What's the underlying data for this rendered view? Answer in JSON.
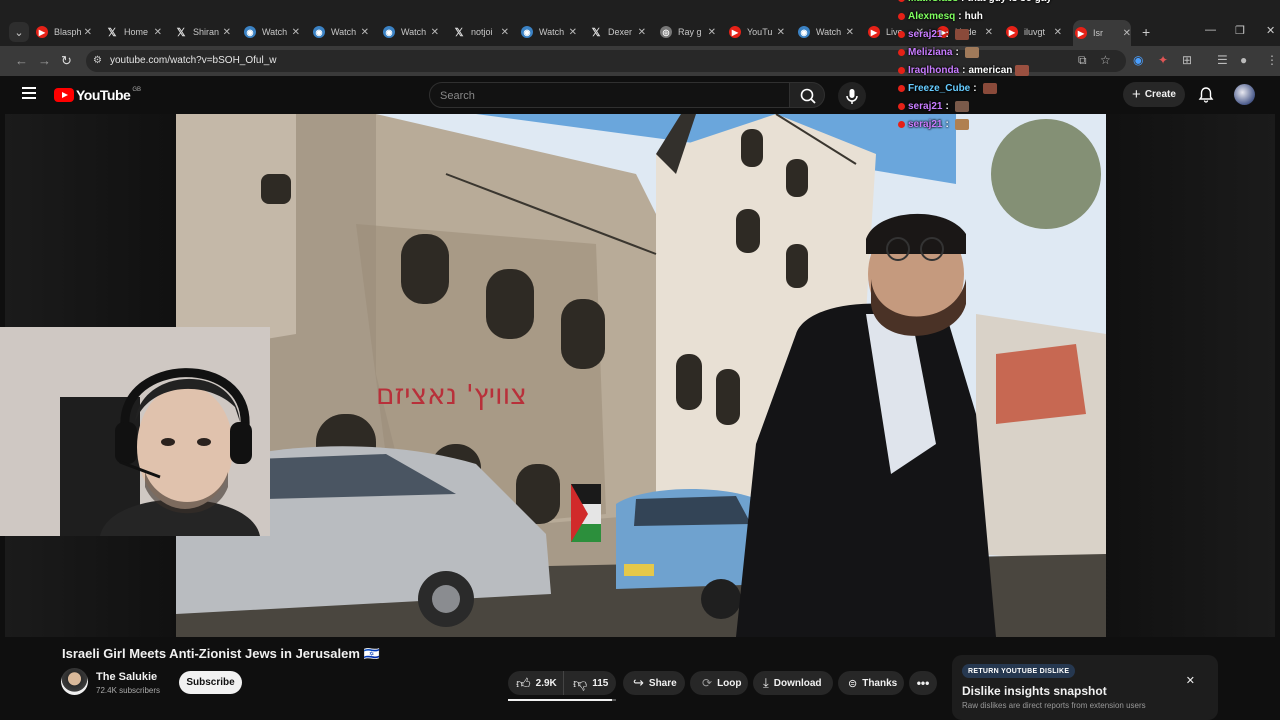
{
  "browser": {
    "tabs": [
      {
        "label": "Blasph",
        "icon": "youtube-icon"
      },
      {
        "label": "Home",
        "icon": "x-icon"
      },
      {
        "label": "Shiran",
        "icon": "x-icon"
      },
      {
        "label": "Watch",
        "icon": "watch-icon"
      },
      {
        "label": "Watch",
        "icon": "watch-icon"
      },
      {
        "label": "Watch",
        "icon": "watch-icon"
      },
      {
        "label": "notjoi",
        "icon": "x-icon"
      },
      {
        "label": "Watch",
        "icon": "watch-icon"
      },
      {
        "label": "Dexer",
        "icon": "x-icon"
      },
      {
        "label": "Ray g",
        "icon": "chrome-icon"
      },
      {
        "label": "YouTu",
        "icon": "youtube-icon"
      },
      {
        "label": "Watch",
        "icon": "watch-icon"
      },
      {
        "label": "Live",
        "icon": "youtube-icon"
      },
      {
        "label": "Unde",
        "icon": "youtube-icon"
      },
      {
        "label": "iluvgt",
        "icon": "youtube-icon"
      },
      {
        "label": "Isr",
        "icon": "youtube-icon"
      }
    ],
    "url": "youtube.com/watch?v=bSOH_Oful_w"
  },
  "youtube": {
    "logo_text": "YouTube",
    "country_code": "GB",
    "search_placeholder": "Search",
    "create_label": "Create"
  },
  "video": {
    "title": "Israeli Girl Meets Anti-Zionist Jews in Jerusalem 🇮🇱",
    "channel_name": "The Salukie",
    "subscribers": "72.4K subscribers",
    "subscribe_label": "Subscribe",
    "likes": "2.9K",
    "dislikes": "115",
    "share_label": "Share",
    "loop_label": "Loop",
    "download_label": "Download",
    "thanks_label": "Thanks",
    "like_ratio": 0.96,
    "graffiti_text": "צוויץ' נאציזם"
  },
  "chat": [
    {
      "user": "MathClass",
      "message": "that guy is so gay",
      "color": "#7fff5f"
    },
    {
      "user": "Alexmesq",
      "message": "huh",
      "color": "#7fff5f"
    },
    {
      "user": "seraj21",
      "message": "",
      "color": "#c87cff"
    },
    {
      "user": "Meliziana",
      "message": "",
      "color": "#c87cff"
    },
    {
      "user": "Iraqlhonda",
      "message": "american",
      "color": "#c87cff"
    },
    {
      "user": "Freeze_Cube",
      "message": "",
      "color": "#66ccff"
    },
    {
      "user": "seraj21",
      "message": "",
      "color": "#c87cff"
    },
    {
      "user": "seraj21",
      "message": "",
      "color": "#c87cff"
    }
  ],
  "ryd": {
    "badge": "RETURN YOUTUBE DISLIKE",
    "title": "Dislike insights snapshot",
    "subtitle": "Raw dislikes are direct reports from extension users"
  }
}
